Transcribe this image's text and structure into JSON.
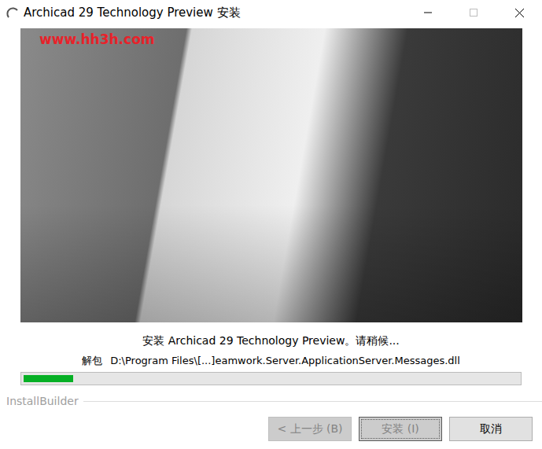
{
  "window": {
    "title": "Archicad 29 Technology Preview 安装",
    "maximize_disabled": true
  },
  "watermark": "www.hh3h.com",
  "status": "安装 Archicad 29 Technology Preview。请稍候...",
  "action": {
    "label": "解包",
    "path": "D:\\Program Files\\[...]eamwork.Server.ApplicationServer.Messages.dll"
  },
  "progress": {
    "level": 0.1
  },
  "brand": "InstallBuilder",
  "buttons": [
    {
      "label": "< 上一步 (B)",
      "disabled": true,
      "focused": false
    },
    {
      "label": "安装 (I)",
      "disabled": true,
      "focused": true
    },
    {
      "label": "取消",
      "disabled": false,
      "focused": false
    }
  ]
}
